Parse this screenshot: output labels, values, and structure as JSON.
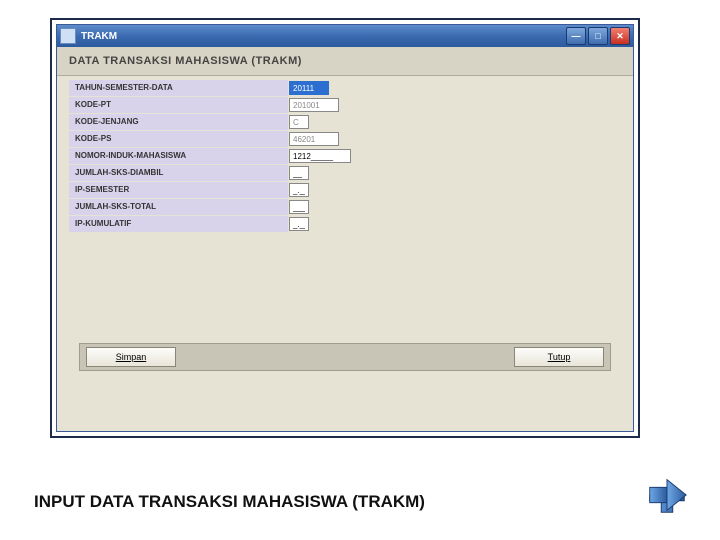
{
  "window": {
    "title": "TRAKM",
    "header": "DATA TRANSAKSI MAHASISWA (TRAKM)"
  },
  "fields": [
    {
      "label": "TAHUN-SEMESTER-DATA",
      "value": "20111",
      "style": "highlight"
    },
    {
      "label": "KODE-PT",
      "value": "201001",
      "style": "readonly"
    },
    {
      "label": "KODE-JENJANG",
      "value": "C",
      "style": "short"
    },
    {
      "label": "KODE-PS",
      "value": "46201",
      "style": "readonly"
    },
    {
      "label": "NOMOR-INDUK-MAHASISWA",
      "value": "1212_____",
      "style": "nim"
    },
    {
      "label": "JUMLAH-SKS-DIAMBIL",
      "value": "__",
      "style": "short"
    },
    {
      "label": "IP-SEMESTER",
      "value": "_.__",
      "style": "short"
    },
    {
      "label": "JUMLAH-SKS-TOTAL",
      "value": "___",
      "style": "short"
    },
    {
      "label": "IP-KUMULATIF",
      "value": "_.__",
      "style": "short"
    }
  ],
  "buttons": {
    "save": "Simpan",
    "close": "Tutup"
  },
  "caption": "INPUT DATA TRANSAKSI MAHASISWA (TRAKM)"
}
